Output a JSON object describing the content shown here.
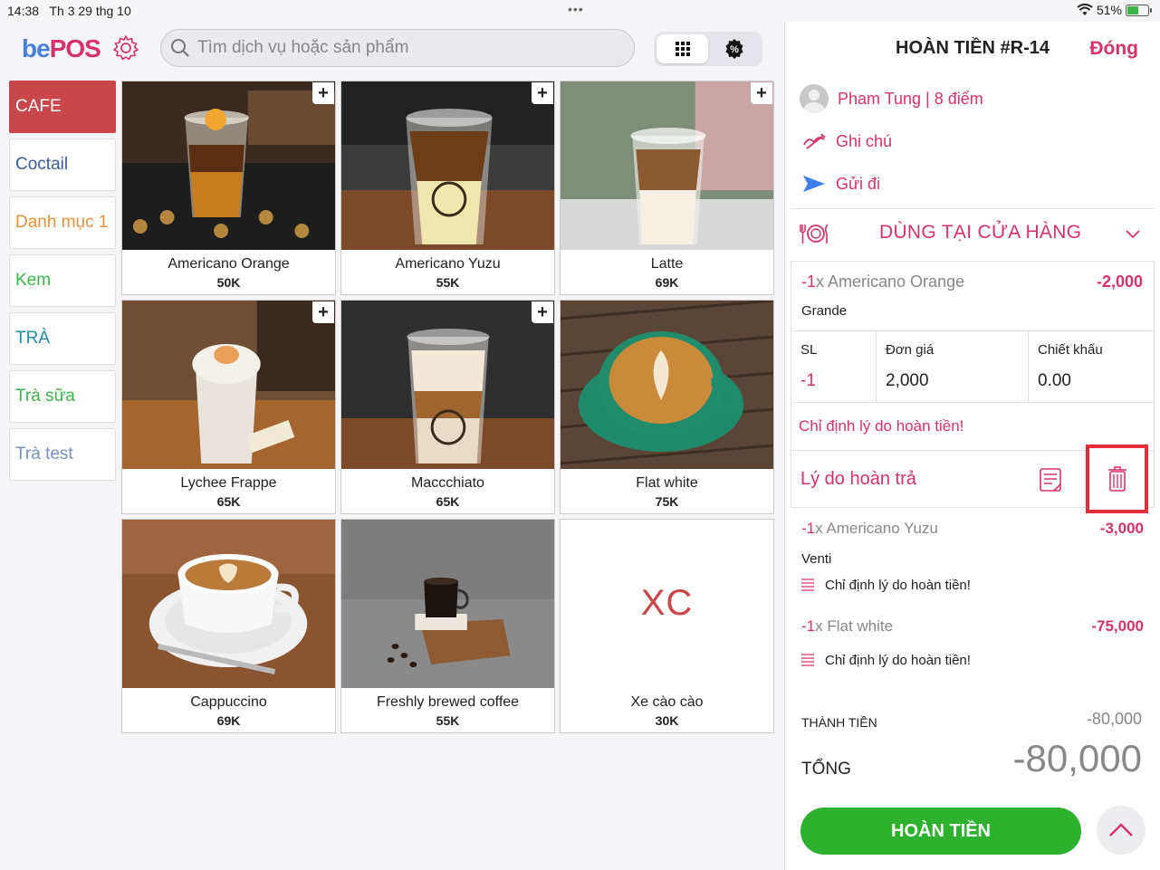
{
  "status_bar": {
    "time": "14:38",
    "date": "Th 3 29 thg 10",
    "battery": "51%"
  },
  "header": {
    "logo_be": "be",
    "logo_pos": "POS",
    "search_placeholder": "Tìm dịch vụ hoặc sản phẩm"
  },
  "categories": [
    {
      "label": "CAFE",
      "color": "#ffffff"
    },
    {
      "label": "Coctail",
      "color": "#3d5a9e"
    },
    {
      "label": "Danh mục 1",
      "color": "#e8913a"
    },
    {
      "label": "Kem",
      "color": "#3bb54a"
    },
    {
      "label": "TRÀ",
      "color": "#1f8fa8"
    },
    {
      "label": "Trà sữa",
      "color": "#3bb54a"
    },
    {
      "label": "Trà test",
      "color": "#7a8fc8"
    }
  ],
  "products": [
    {
      "name": "Americano Orange",
      "price": "50K"
    },
    {
      "name": "Americano Yuzu",
      "price": "55K"
    },
    {
      "name": "Latte",
      "price": "69K"
    },
    {
      "name": "Lychee Frappe",
      "price": "65K"
    },
    {
      "name": "Maccchiato",
      "price": "65K"
    },
    {
      "name": "Flat white",
      "price": "75K"
    },
    {
      "name": "Cappuccino",
      "price": "69K"
    },
    {
      "name": "Freshly brewed coffee",
      "price": "55K"
    },
    {
      "name": "Xe cào cào",
      "price": "30K",
      "initials": "XC"
    }
  ],
  "refund": {
    "title": "HOÀN TIỀN #R-14",
    "close": "Đóng",
    "customer": "Pham Tung | 8 điểm",
    "note": "Ghi chú",
    "send": "Gửi đi",
    "dine_mode": "DÙNG TẠI CỬA HÀNG",
    "selected_item": {
      "qty": "-1",
      "name": "x Americano Orange",
      "amount": "-2,000",
      "size": "Grande",
      "col_qty": "SL",
      "col_price": "Đơn giá",
      "col_discount": "Chiết khấu",
      "qty_value": "-1",
      "price_value": "2,000",
      "discount_value": "0.00",
      "reason_prompt": "Chỉ định lý do hoàn tiền!",
      "reason_label": "Lý do hoàn trả"
    },
    "items": [
      {
        "qty": "-1",
        "name": "x Americano Yuzu",
        "amount": "-3,000",
        "size": "Venti",
        "note": "Chỉ định lý do hoàn tiền!"
      },
      {
        "qty": "-1",
        "name": "x Flat white",
        "amount": "-75,000",
        "note": "Chỉ định lý do hoàn tiền!"
      }
    ],
    "subtotal_label": "THÀNH TIỀN",
    "subtotal": "-80,000",
    "total_label": "TỔNG",
    "total": "-80,000",
    "refund_button": "HOÀN TIỀN"
  }
}
